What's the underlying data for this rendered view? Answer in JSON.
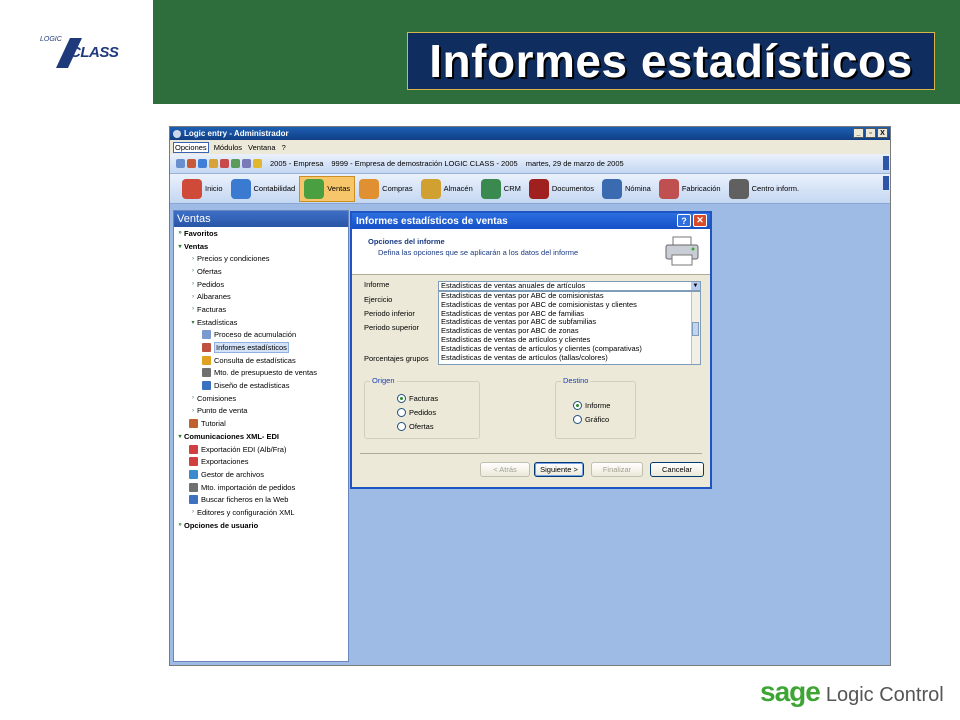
{
  "slide": {
    "title": "Informes estadísticos",
    "logo_small": "LOGIC",
    "logo_big": "CLASS",
    "sage_brand": "sage",
    "sage_product": "Logic Control"
  },
  "window": {
    "title": "Logic entry - Administrador",
    "controls": [
      "_",
      "▫",
      "X"
    ]
  },
  "menu": [
    "Opciones",
    "Módulos",
    "Ventana",
    "?"
  ],
  "infobar": {
    "year": "2005 - Empresa",
    "company": "9999 - Empresa de demostración LOGIC CLASS - 2005",
    "date": "martes, 29 de marzo de 2005"
  },
  "toolbar": [
    {
      "label": "Inicio",
      "icon": "home-icon",
      "color": "#d04a3a"
    },
    {
      "label": "Contabilidad",
      "icon": "scales-icon",
      "color": "#3a7ad0"
    },
    {
      "label": "Ventas",
      "icon": "sales-chart-icon",
      "color": "#4aa040",
      "active": true
    },
    {
      "label": "Compras",
      "icon": "basket-icon",
      "color": "#e09030"
    },
    {
      "label": "Almacén",
      "icon": "warehouse-icon",
      "color": "#d0a030"
    },
    {
      "label": "CRM",
      "icon": "people-icon",
      "color": "#3a8a50"
    },
    {
      "label": "Documentos",
      "icon": "binders-icon",
      "color": "#a02020"
    },
    {
      "label": "Nómina",
      "icon": "payroll-icon",
      "color": "#3a6ab0"
    },
    {
      "label": "Fabricación",
      "icon": "factory-icon",
      "color": "#c05050"
    },
    {
      "label": "Centro inform.",
      "icon": "info-center-icon",
      "color": "#606060"
    }
  ],
  "nav": {
    "header": "Ventas",
    "items": [
      {
        "label": "Favoritos",
        "level": 0,
        "bold": true,
        "chev": "»"
      },
      {
        "label": "Ventas",
        "level": 0,
        "bold": true,
        "chev": "▾"
      },
      {
        "label": "Precios y condiciones",
        "level": 1,
        "chev": "›"
      },
      {
        "label": "Ofertas",
        "level": 1,
        "chev": "›"
      },
      {
        "label": "Pedidos",
        "level": 1,
        "chev": "›"
      },
      {
        "label": "Albaranes",
        "level": 1,
        "chev": "›"
      },
      {
        "label": "Facturas",
        "level": 1,
        "chev": "›"
      },
      {
        "label": "Estadísticas",
        "level": 1,
        "chev": "▾"
      },
      {
        "label": "Proceso de acumulación",
        "level": 2,
        "icon": "#7a9ad0"
      },
      {
        "label": "Informes estadísticos",
        "level": 2,
        "icon": "#c05040",
        "selected": true
      },
      {
        "label": "Consulta de estadísticas",
        "level": 2,
        "icon": "#e0a020"
      },
      {
        "label": "Mto. de presupuesto de ventas",
        "level": 2,
        "icon": "#707070"
      },
      {
        "label": "Diseño de estadísticas",
        "level": 2,
        "icon": "#3a70c0"
      },
      {
        "label": "Comisiones",
        "level": 1,
        "chev": "›"
      },
      {
        "label": "Punto de venta",
        "level": 1,
        "chev": "›"
      },
      {
        "label": "Tutorial",
        "level": 1,
        "icon": "#c06030"
      },
      {
        "label": "Comunicaciones XML- EDI",
        "level": 0,
        "bold": true,
        "chev": "▾"
      },
      {
        "label": "Exportación EDI (Alb/Fra)",
        "level": 1,
        "icon": "#d04040"
      },
      {
        "label": "Exportaciones",
        "level": 1,
        "icon": "#d04040"
      },
      {
        "label": "Gestor de archivos",
        "level": 1,
        "icon": "#3a8ad0"
      },
      {
        "label": "Mto. importación de pedidos",
        "level": 1,
        "icon": "#707070"
      },
      {
        "label": "Buscar ficheros en la Web",
        "level": 1,
        "icon": "#4070c0"
      },
      {
        "label": "Editores y configuración XML",
        "level": 1,
        "chev": "›"
      },
      {
        "label": "Opciones de usuario",
        "level": 0,
        "bold": true,
        "chev": "»"
      }
    ]
  },
  "dialog": {
    "title": "Informes estadísticos de ventas",
    "heading": "Opciones del informe",
    "subheading": "Defina las opciones que se aplicarán a los datos del informe",
    "fields": {
      "informe": "Informe",
      "ejercicio": "Ejercicio",
      "periodo_inferior": "Periodo inferior",
      "periodo_superior": "Periodo superior",
      "porcentajes": "Porcentajes grupos"
    },
    "report_selected": "Estadísticas de ventas anuales de artículos",
    "report_options": [
      "Estadísticas de ventas por ABC de comisionistas",
      "Estadísticas de ventas por ABC de comisionistas y clientes",
      "Estadísticas de ventas por ABC de familias",
      "Estadísticas de ventas por ABC de subfamilias",
      "Estadísticas de ventas por ABC de zonas",
      "Estadísticas de ventas de artículos y clientes",
      "Estadísticas de ventas de artículos y clientes (comparativas)",
      "Estadísticas de ventas de artículos (tallas/colores)"
    ],
    "origen": {
      "title": "Origen",
      "options": [
        {
          "label": "Facturas",
          "checked": true
        },
        {
          "label": "Pedidos",
          "checked": false
        },
        {
          "label": "Ofertas",
          "checked": false
        }
      ]
    },
    "destino": {
      "title": "Destino",
      "options": [
        {
          "label": "Informe",
          "checked": true
        },
        {
          "label": "Gráfico",
          "checked": false
        }
      ]
    },
    "buttons": {
      "back": "< Atrás",
      "next": "Siguiente >",
      "finish": "Finalizar",
      "cancel": "Cancelar"
    }
  }
}
